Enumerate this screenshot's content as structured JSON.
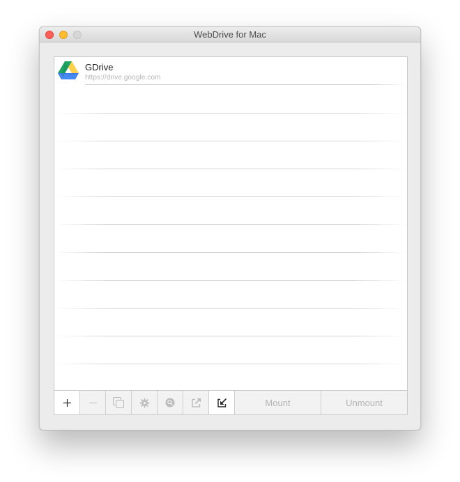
{
  "window": {
    "title": "WebDrive for Mac"
  },
  "accounts": [
    {
      "name": "GDrive",
      "url": "https://drive.google.com",
      "icon": "google-drive-icon"
    }
  ],
  "toolbar": {
    "add_icon": "plus-icon",
    "remove_icon": "minus-icon",
    "duplicate_icon": "duplicate-icon",
    "settings_icon": "gear-icon",
    "search_icon": "search-icon",
    "open_external_icon": "open-external-icon",
    "import_icon": "import-icon",
    "mount_label": "Mount",
    "unmount_label": "Unmount"
  },
  "colors": {
    "drive_green": "#1fa463",
    "drive_yellow": "#ffd04b",
    "drive_blue": "#4688f4"
  }
}
